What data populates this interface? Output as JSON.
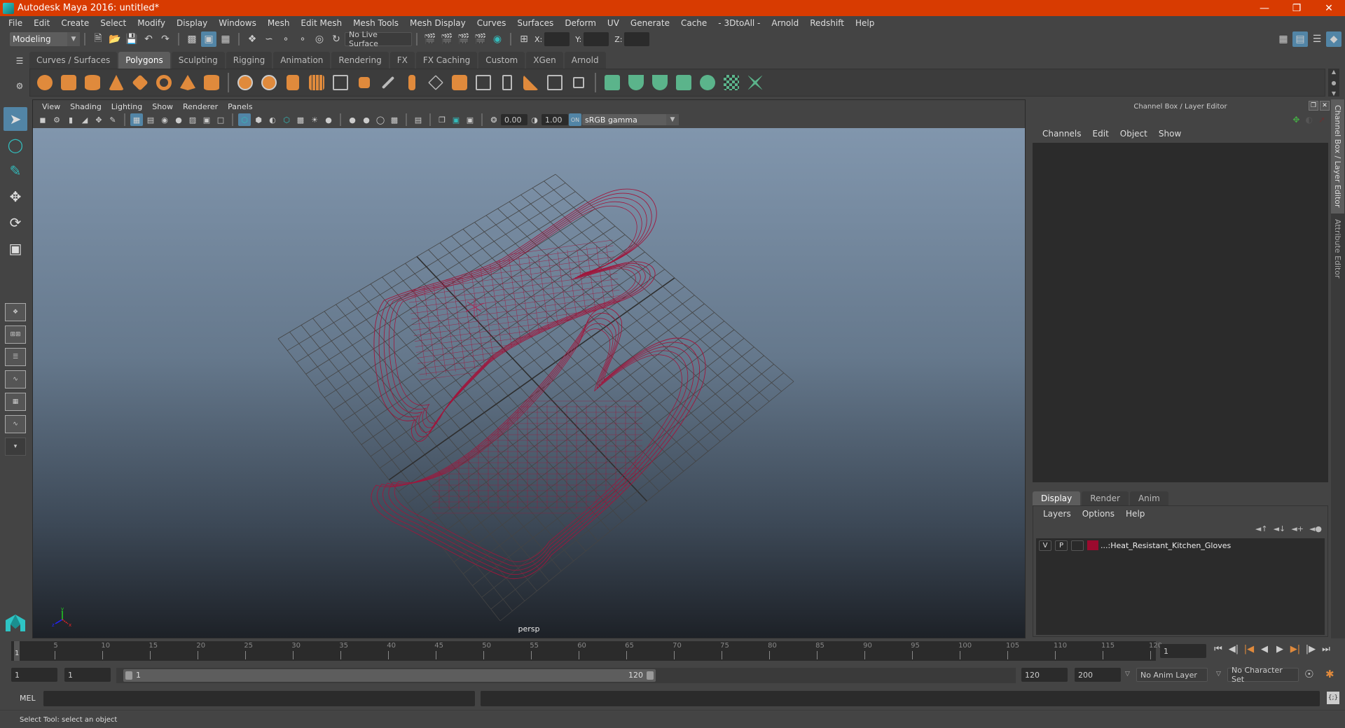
{
  "window": {
    "title": "Autodesk Maya 2016: untitled*",
    "controls": [
      "minimize-icon",
      "restore-icon",
      "close-icon"
    ]
  },
  "menubar": [
    "File",
    "Edit",
    "Create",
    "Select",
    "Modify",
    "Display",
    "Windows",
    "Mesh",
    "Edit Mesh",
    "Mesh Tools",
    "Mesh Display",
    "Curves",
    "Surfaces",
    "Deform",
    "UV",
    "Generate",
    "Cache",
    "- 3DtoAll -",
    "Arnold",
    "Redshift",
    "Help"
  ],
  "statusline": {
    "mode": "Modeling",
    "live_surface": "No Live Surface",
    "x_label": "X:",
    "y_label": "Y:",
    "z_label": "Z:",
    "x_value": "",
    "y_value": "",
    "z_value": ""
  },
  "shelf": {
    "tabs": [
      "Curves / Surfaces",
      "Polygons",
      "Sculpting",
      "Rigging",
      "Animation",
      "Rendering",
      "FX",
      "FX Caching",
      "Custom",
      "XGen",
      "Arnold"
    ],
    "active_tab": "Polygons"
  },
  "viewport": {
    "menu": [
      "View",
      "Shading",
      "Lighting",
      "Show",
      "Renderer",
      "Panels"
    ],
    "exposure": "0.00",
    "gamma": "1.00",
    "color_space": "sRGB gamma",
    "camera_label": "persp",
    "axes": {
      "x": "x",
      "y": "y",
      "z": "z"
    },
    "wire_color": "#a0163c"
  },
  "channel_box": {
    "title": "Channel Box / Layer Editor",
    "menu": [
      "Channels",
      "Edit",
      "Object",
      "Show"
    ]
  },
  "layer_editor": {
    "tabs": [
      "Display",
      "Render",
      "Anim"
    ],
    "active_tab": "Display",
    "menu": [
      "Layers",
      "Options",
      "Help"
    ],
    "layers": [
      {
        "visible": "V",
        "playback": "P",
        "color": "#9b0a2e",
        "name": "...:Heat_Resistant_Kitchen_Gloves"
      }
    ]
  },
  "side_tabs": [
    "Channel Box / Layer Editor",
    "Attribute Editor"
  ],
  "timeline": {
    "ticks": [
      5,
      10,
      15,
      20,
      25,
      30,
      35,
      40,
      45,
      50,
      55,
      60,
      65,
      70,
      75,
      80,
      85,
      90,
      95,
      100,
      105,
      110,
      115,
      120
    ],
    "current_frame": "1",
    "current_frame_field": "1"
  },
  "range": {
    "start": "1",
    "playback_start": "1",
    "slider_start": "1",
    "slider_end": "120",
    "playback_end": "120",
    "end": "200",
    "anim_layer": "No Anim Layer",
    "character_set": "No Character Set"
  },
  "command_line": {
    "label": "MEL",
    "value": ""
  },
  "help_line": "Select Tool: select an object"
}
